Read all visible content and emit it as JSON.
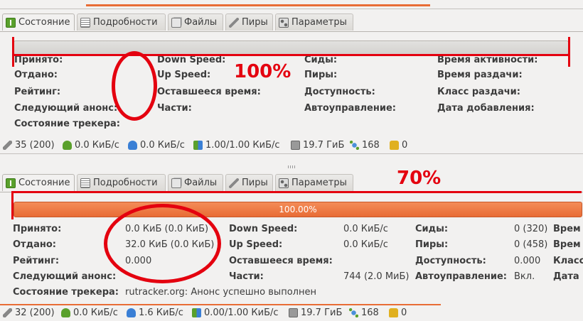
{
  "tabs": [
    "Состояние",
    "Подробности",
    "Файлы",
    "Пиры",
    "Параметры"
  ],
  "annotations": {
    "top_percent": "100%",
    "bottom_percent": "70%"
  },
  "top_panel": {
    "labels": {
      "received": "Принято:",
      "sent": "Отдано:",
      "rating": "Рейтинг:",
      "next_announce": "Следующий анонс:",
      "tracker_status": "Состояние трекера:",
      "down_speed": "Down Speed:",
      "up_speed": "Up Speed:",
      "eta": "Оставшееся время:",
      "pieces": "Части:",
      "seeds": "Сиды:",
      "peers": "Пиры:",
      "availability": "Доступность:",
      "auto_managed": "Автоуправление:",
      "active_time": "Время активности:",
      "seeding_time": "Время раздачи:",
      "seed_rank": "Класс раздачи:",
      "date_added": "Дата добавления:"
    }
  },
  "top_status": {
    "connections": "35 (200)",
    "download": "0.0 КиБ/с",
    "upload": "0.0 КиБ/с",
    "protocol": "1.00/1.00 КиБ/с",
    "disk": "19.7 ГиБ",
    "dht": "168",
    "blocked": "0"
  },
  "bottom_panel": {
    "progress": "100.00%",
    "progress_fraction": 1.0,
    "labels": {
      "received": "Принято:",
      "sent": "Отдано:",
      "rating": "Рейтинг:",
      "next_announce": "Следующий анонс:",
      "tracker_status": "Состояние трекера:",
      "down_speed": "Down Speed:",
      "up_speed": "Up Speed:",
      "eta": "Оставшееся время:",
      "pieces": "Части:",
      "seeds": "Сиды:",
      "peers": "Пиры:",
      "availability": "Доступность:",
      "auto_managed": "Автоуправление:",
      "col4_1": "Врем",
      "col4_2": "Врем",
      "col4_3": "Класс",
      "col4_4": "Дата"
    },
    "values": {
      "received": "0.0 КиБ (0.0 КиБ)",
      "sent": "32.0 КиБ (0.0 КиБ)",
      "rating": "0.000",
      "tracker_status": "rutracker.org: Анонс успешно выполнен",
      "down_speed": "0.0 КиБ/с",
      "up_speed": "0.0 КиБ/с",
      "pieces": "744 (2.0 МиБ)",
      "seeds": "0 (320)",
      "peers": "0 (458)",
      "availability": "0.000",
      "auto_managed": "Вкл."
    }
  },
  "bottom_status": {
    "connections": "32 (200)",
    "download": "0.0 КиБ/с",
    "upload": "1.6 КиБ/с",
    "protocol": "0.00/1.00 КиБ/с",
    "disk": "19.7 ГиБ",
    "dht": "168",
    "blocked": "0"
  },
  "colors": {
    "annotation": "#e4000f",
    "progress": "#e86c35",
    "accent_green": "#5aa02c"
  }
}
